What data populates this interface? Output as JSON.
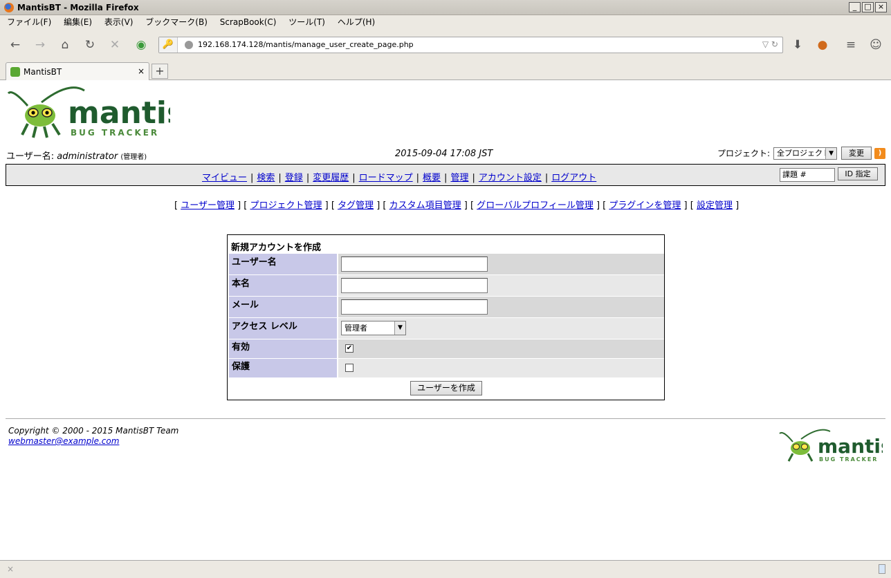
{
  "window": {
    "title": "MantisBT - Mozilla Firefox"
  },
  "menubar": [
    "ファイル(F)",
    "編集(E)",
    "表示(V)",
    "ブックマーク(B)",
    "ScrapBook(C)",
    "ツール(T)",
    "ヘルプ(H)"
  ],
  "address": {
    "url": "192.168.174.128/mantis/manage_user_create_page.php"
  },
  "tab": {
    "title": "MantisBT"
  },
  "logo": {
    "main": "mantis",
    "sub": "BUG TRACKER"
  },
  "header": {
    "user_label": "ユーザー名:",
    "username": "administrator",
    "role": "(管理者)",
    "datetime": "2015-09-04 17:08 JST",
    "project_label": "プロジェクト:",
    "project_value": "全プロジェクト",
    "change_button": "変更"
  },
  "mainmenu": {
    "items": [
      "マイビュー",
      "検索",
      "登録",
      "変更履歴",
      "ロードマップ",
      "概要",
      "管理",
      "アカウント設定",
      "ログアウト"
    ],
    "issue_placeholder": "課題 #",
    "id_button": "ID 指定"
  },
  "submenu": [
    "ユーザー管理",
    "プロジェクト管理",
    "タグ管理",
    "カスタム項目管理",
    "グローバルプロフィール管理",
    "プラグインを管理",
    "設定管理"
  ],
  "form": {
    "title": "新規アカウントを作成",
    "fields": {
      "username_label": "ユーザー名",
      "realname_label": "本名",
      "email_label": "メール",
      "access_label": "アクセス レベル",
      "access_value": "管理者",
      "enabled_label": "有効",
      "enabled": true,
      "protected_label": "保護",
      "protected": false
    },
    "submit": "ユーザーを作成"
  },
  "footer": {
    "copyright": "Copyright © 2000 - 2015 MantisBT Team",
    "email": "webmaster@example.com"
  },
  "colors": {
    "label_bg": "#c8c8e8",
    "row_dark": "#d8d8d8",
    "row_light": "#e8e8e8",
    "link": "#0000cc",
    "logo_green": "#1f5b2e"
  }
}
